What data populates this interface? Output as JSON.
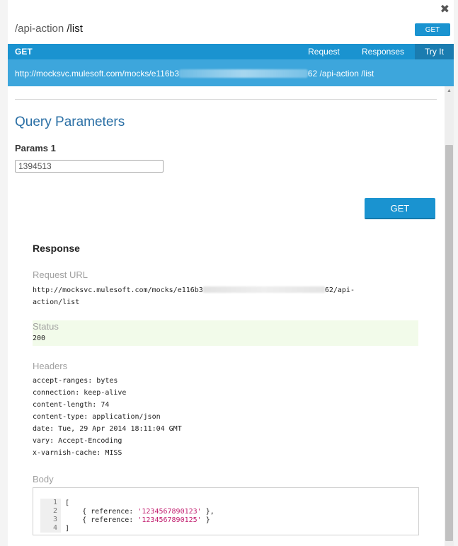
{
  "header": {
    "close_glyph": "✖",
    "resource": "/api-action",
    "segment": "/list",
    "method_badge": "GET"
  },
  "bar": {
    "method": "GET",
    "tabs": [
      "Request",
      "Responses",
      "Try It"
    ],
    "active_tab": "Try It"
  },
  "url": {
    "prefix": "http://mocksvc.mulesoft.com/mocks/e116b3",
    "suffix": "62 /api-action /list"
  },
  "query": {
    "title": "Query Parameters",
    "param_label": "Params 1",
    "param_value": "1394513",
    "submit_label": "GET"
  },
  "response": {
    "title": "Response",
    "request_url_label": "Request URL",
    "request_url_prefix": "http://mocksvc.mulesoft.com/mocks/e116b3",
    "request_url_suffix": "62/api-",
    "request_url_line2": "action/list",
    "status_label": "Status",
    "status_value": "200",
    "headers_label": "Headers",
    "headers": [
      "accept-ranges: bytes",
      "connection: keep-alive",
      "content-length: 74",
      "content-type: application/json",
      "date: Tue, 29 Apr 2014 18:11:04 GMT",
      "vary: Accept-Encoding",
      "x-varnish-cache: MISS"
    ],
    "body_label": "Body",
    "body_lines": [
      {
        "num": "1",
        "pre": "[",
        "str": "",
        "post": ""
      },
      {
        "num": "2",
        "pre": "    { reference: ",
        "str": "'1234567890123'",
        "post": " },"
      },
      {
        "num": "3",
        "pre": "    { reference: ",
        "str": "'1234567890125'",
        "post": " }"
      },
      {
        "num": "4",
        "pre": "]",
        "str": "",
        "post": ""
      }
    ]
  },
  "colors": {
    "accent": "#1a93d0",
    "url_bar": "#3da6dc",
    "status_bg": "#f2fbea",
    "string": "#c11b6d"
  }
}
